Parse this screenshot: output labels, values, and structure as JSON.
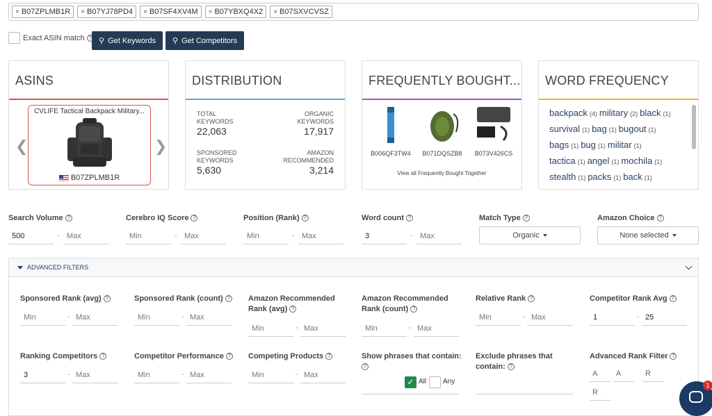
{
  "asin_chips": [
    "B07ZPLMB1R",
    "B07YJ78PD4",
    "B07SF4XV4M",
    "B07YBXQ4X2",
    "B07SXVCVSZ"
  ],
  "toolbar": {
    "exact_label": "Exact ASIN match",
    "get_keywords": "Get Keywords",
    "get_competitors": "Get Competitors"
  },
  "cards": {
    "asins": {
      "title": "ASINS",
      "product_name": "CVLIFE Tactical Backpack Military...",
      "product_asin": "B07ZPLMB1R",
      "accent": "#d9534f"
    },
    "distribution": {
      "title": "DISTRIBUTION",
      "accent": "#5aa7d6",
      "total_keywords_label": "TOTAL KEYWORDS",
      "total_keywords": "22,063",
      "organic_keywords_label": "ORGANIC KEYWORDS",
      "organic_keywords": "17,917",
      "sponsored_keywords_label": "SPONSORED KEYWORDS",
      "sponsored_keywords": "5,630",
      "amazon_recommended_label": "AMAZON RECOMMENDED",
      "amazon_recommended": "3,214"
    },
    "frequently_bought": {
      "title": "FREQUENTLY BOUGHT...",
      "accent": "#9b59b6",
      "items": [
        "B006QF3TW4",
        "B071DQSZB8",
        "B073V426CS"
      ],
      "view_all": "View all Frequently Bought Together"
    },
    "word_frequency": {
      "title": "WORD FREQUENCY",
      "accent": "#f0b429",
      "words": [
        {
          "w": "backpack",
          "c": "(4)"
        },
        {
          "w": "military",
          "c": "(2)"
        },
        {
          "w": "black",
          "c": "(1)"
        },
        {
          "w": "survival",
          "c": "(1)"
        },
        {
          "w": "bag",
          "c": "(1)"
        },
        {
          "w": "bugout",
          "c": "(1)"
        },
        {
          "w": "bags",
          "c": "(1)"
        },
        {
          "w": "bug",
          "c": "(1)"
        },
        {
          "w": "militar",
          "c": "(1)"
        },
        {
          "w": "tactica",
          "c": "(1)"
        },
        {
          "w": "angel",
          "c": "(1)"
        },
        {
          "w": "mochila",
          "c": "(1)"
        },
        {
          "w": "stealth",
          "c": "(1)"
        },
        {
          "w": "packs",
          "c": "(1)"
        },
        {
          "w": "back",
          "c": "(1)"
        }
      ]
    }
  },
  "filters": {
    "search_volume": {
      "label": "Search Volume",
      "min": "500",
      "max": "Max"
    },
    "cerebro_iq": {
      "label": "Cerebro IQ Score",
      "min": "Min",
      "max": "Max"
    },
    "position_rank": {
      "label": "Position (Rank)",
      "min": "Min",
      "max": "Max"
    },
    "word_count": {
      "label": "Word count",
      "min": "3",
      "max": "Max"
    },
    "match_type": {
      "label": "Match Type",
      "value": "Organic"
    },
    "amazon_choice": {
      "label": "Amazon Choice",
      "value": "None selected"
    }
  },
  "advanced": {
    "header": "ADVANCED FILTERS",
    "sponsored_rank_avg": {
      "label": "Sponsored Rank (avg)",
      "min": "Min",
      "max": "Max"
    },
    "sponsored_rank_count": {
      "label": "Sponsored Rank (count)",
      "min": "Min",
      "max": "Max"
    },
    "amazon_rec_rank_avg": {
      "label1": "Amazon Recommended",
      "label2": "Rank (avg)",
      "min": "Min",
      "max": "Max"
    },
    "amazon_rec_rank_count": {
      "label1": "Amazon Recommended",
      "label2": "Rank (count)",
      "min": "Min",
      "max": "Max"
    },
    "relative_rank": {
      "label": "Relative Rank",
      "min": "Min",
      "max": "Max"
    },
    "competitor_rank_avg": {
      "label": "Competitor Rank Avg",
      "min": "1",
      "max": "25"
    },
    "ranking_competitors": {
      "label": "Ranking Competitors",
      "min": "3",
      "max": "Max"
    },
    "competitor_performance": {
      "label": "Competitor Performance",
      "min": "Min",
      "max": "Max"
    },
    "competing_products": {
      "label": "Competing Products",
      "min": "Min",
      "max": "Max"
    },
    "show_phrases": {
      "label": "Show phrases that contain:",
      "all": "All",
      "any": "Any"
    },
    "exclude_phrases": {
      "label1": "Exclude phrases that",
      "label2": "contain:"
    },
    "advanced_rank_filter": {
      "label": "Advanced Rank Filter",
      "a1": "A",
      "a2": "A",
      "r1": "R",
      "r2": "R"
    }
  },
  "chat": {
    "badge": "1"
  }
}
